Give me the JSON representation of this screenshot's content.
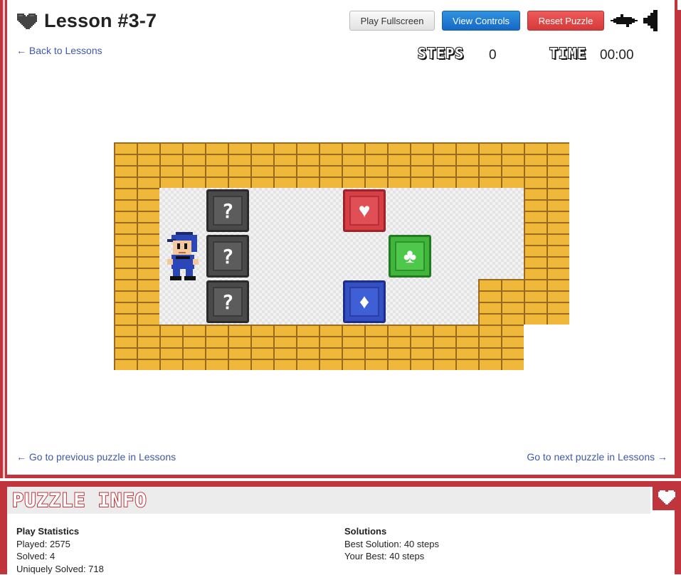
{
  "header": {
    "title": "Lesson #3-7",
    "back_link": "← Back to Lessons",
    "buttons": {
      "fullscreen": "Play Fullscreen",
      "controls": "View Controls",
      "reset": "Reset Puzzle"
    },
    "icons": [
      "heart-icon",
      "music-icon",
      "sound-icon"
    ]
  },
  "stats": {
    "steps_label": "STEPS",
    "steps_value": "0",
    "time_label": "TIME",
    "time_value": "00:00"
  },
  "board": {
    "crates": [
      {
        "kind": "mystery",
        "symbol": "?",
        "color": "#4a4a4a"
      },
      {
        "kind": "mystery",
        "symbol": "?",
        "color": "#4a4a4a"
      },
      {
        "kind": "mystery",
        "symbol": "?",
        "color": "#4a4a4a"
      },
      {
        "kind": "heart",
        "symbol": "♥",
        "color": "#d63f45"
      },
      {
        "kind": "club",
        "symbol": "♣",
        "color": "#3fb63b"
      },
      {
        "kind": "diamond",
        "symbol": "♦",
        "color": "#3550c4"
      }
    ],
    "colors": {
      "brick": "#f0b83a",
      "mortar": "#9a6a1c",
      "floor": "#f2f2f2"
    }
  },
  "nav": {
    "prev": "← Go to previous puzzle in Lessons",
    "next": "Go to next puzzle in Lessons →"
  },
  "info": {
    "title": "PUZZLE INFO",
    "play_statistics": {
      "heading": "Play Statistics",
      "played": "Played: 2575",
      "solved": "Solved: 4",
      "uniquely_solved": "Uniquely Solved: 718"
    },
    "solutions": {
      "heading": "Solutions",
      "best": "Best Solution: 40 steps",
      "yours": "Your Best: 40 steps"
    }
  },
  "theme": {
    "frame": "#c0343c",
    "link": "#3d5aa8"
  }
}
